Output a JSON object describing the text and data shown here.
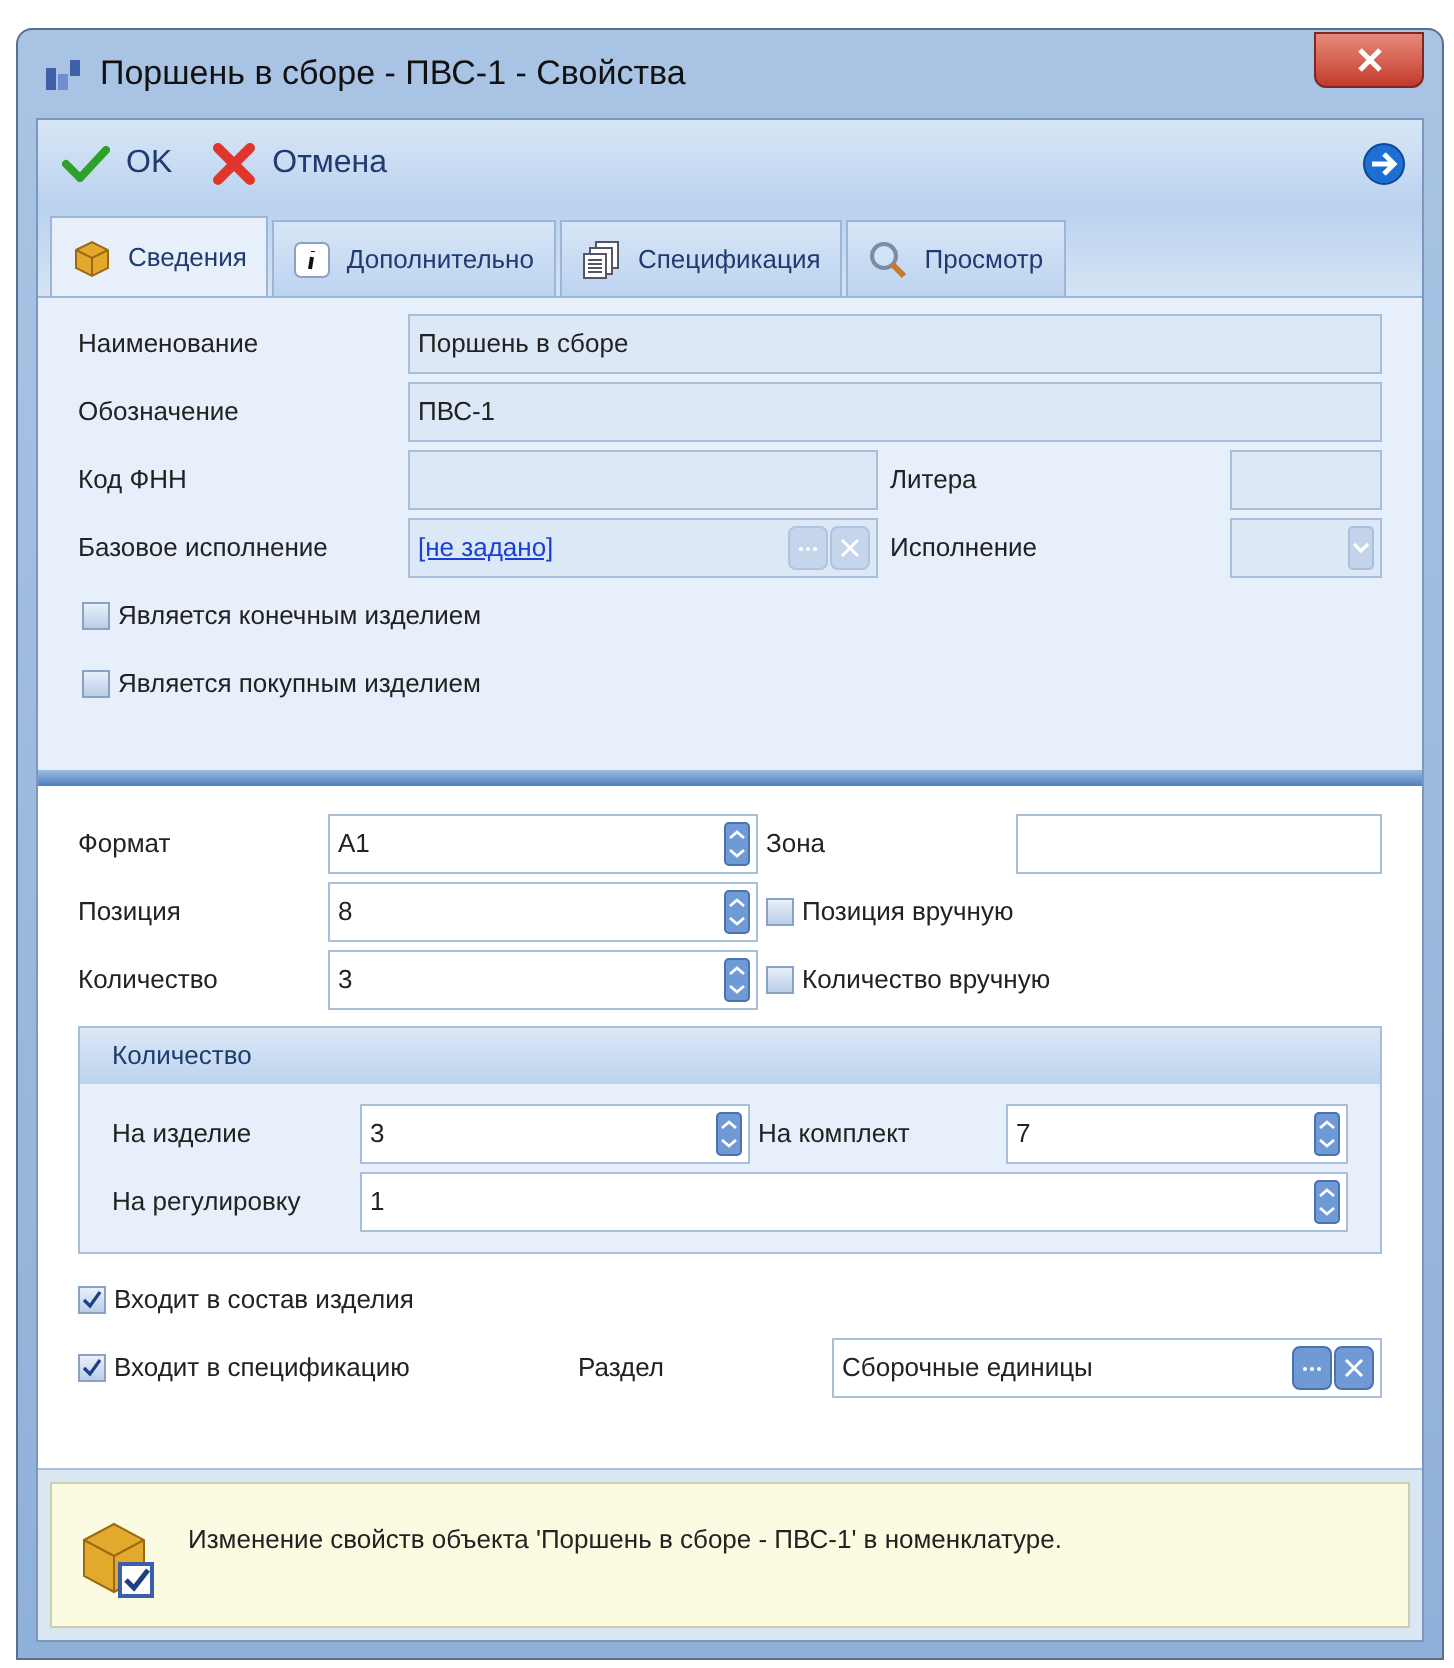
{
  "window": {
    "title": "Поршень в сборе - ПВС-1 - Свойства"
  },
  "toolbar": {
    "buttons": [
      {
        "label": "OK",
        "kind": "ok"
      },
      {
        "label": "Отмена",
        "kind": "cancel"
      }
    ]
  },
  "tabs": [
    {
      "label": "Сведения",
      "kind": "box",
      "selected": true
    },
    {
      "label": "Дополнительно",
      "kind": "info",
      "selected": false
    },
    {
      "label": "Спецификация",
      "kind": "pages",
      "selected": false
    },
    {
      "label": "Просмотр",
      "kind": "search",
      "selected": false
    }
  ],
  "details": {
    "name": {
      "label": "Наименование",
      "value": "Поршень в сборе"
    },
    "designation": {
      "label": "Обозначение",
      "value": "ПВС-1"
    },
    "fnn_code": {
      "label": "Код ФНН"
    },
    "litera": {
      "label": "Литера"
    },
    "base_version": {
      "label": "Базовое исполнение",
      "value": "[не задано]"
    },
    "version": {
      "label": "Исполнение"
    },
    "checkboxes": [
      {
        "label": "Является конечным изделием",
        "checked": false
      },
      {
        "label": "Является покупным изделием",
        "checked": false
      }
    ]
  },
  "placement": {
    "format": {
      "label": "Формат",
      "value": "A1"
    },
    "zone": {
      "label": "Зона"
    },
    "position": {
      "label": "Позиция",
      "value": "8"
    },
    "position_manual": {
      "label": "Позиция вручную",
      "checked": false
    },
    "quantity": {
      "label": "Количество",
      "value": "3"
    },
    "quantity_manual": {
      "label": "Количество вручную",
      "checked": false
    },
    "quantity_group": {
      "title": "Количество",
      "per_item": {
        "label": "На изделие",
        "value": "3"
      },
      "per_set": {
        "label": "На комплект",
        "value": "7"
      },
      "per_adjustment": {
        "label": "На регулировку",
        "value": "1"
      }
    },
    "in_product": {
      "label": "Входит в состав изделия",
      "checked": true
    },
    "in_spec": {
      "label": "Входит в спецификацию",
      "checked": true
    },
    "section": {
      "label": "Раздел",
      "value": "Сборочные единицы"
    }
  },
  "message": "Изменение свойств объекта 'Поршень в сборе - ПВС-1' в номенклатуре."
}
